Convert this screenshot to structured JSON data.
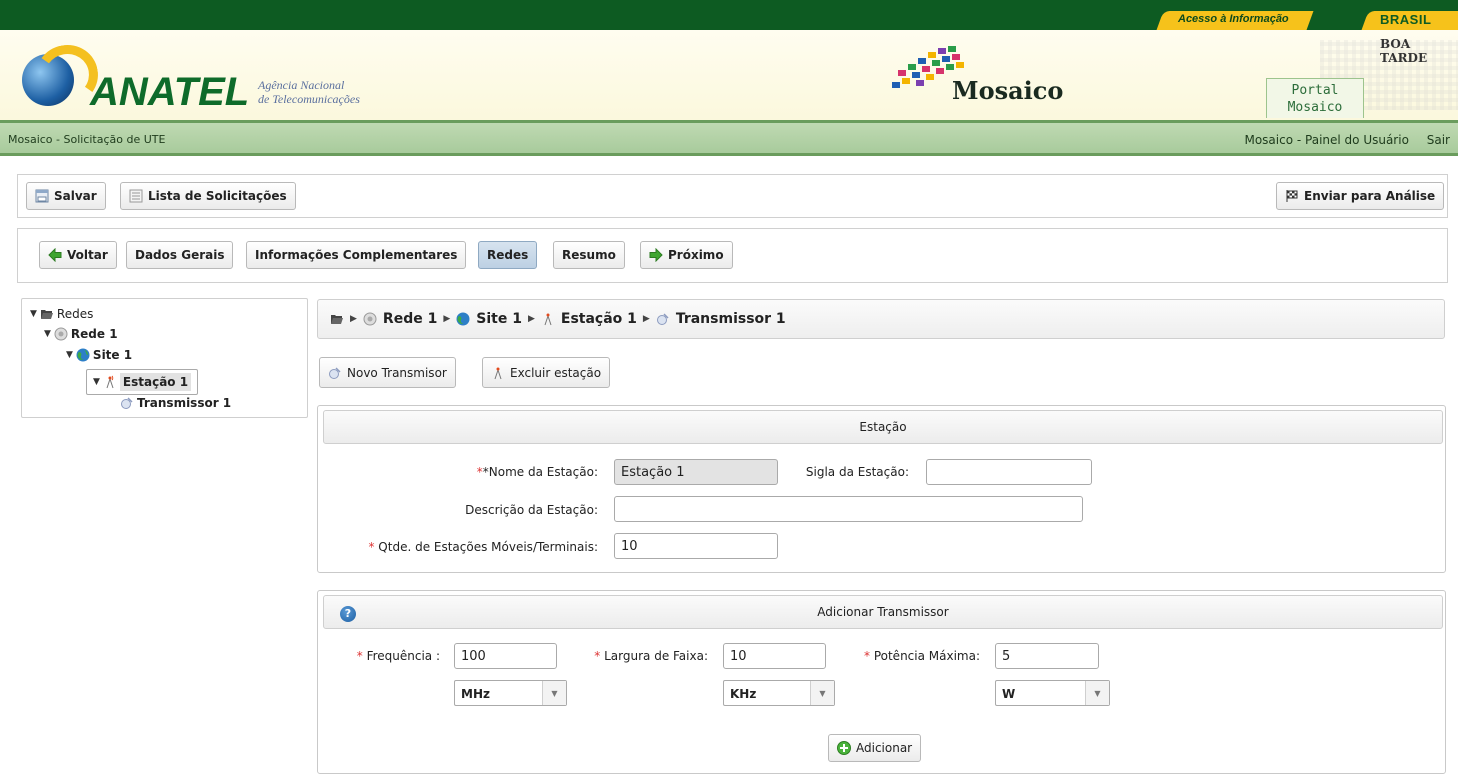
{
  "gov_bar": {
    "acesso": "Acesso à Informação",
    "brasil": "BRASIL"
  },
  "header": {
    "brand": "ANATEL",
    "agency_line1": "Agência Nacional",
    "agency_line2": "de Telecomunicações",
    "app_name": "Mosaico",
    "greeting": "BOA TARDE",
    "portal_line1": "Portal",
    "portal_line2": "Mosaico"
  },
  "subnav": {
    "left": "Mosaico - Solicitação de UTE",
    "panel_link": "Mosaico - Painel do Usuário",
    "logout": "Sair"
  },
  "toolbar": {
    "save": "Salvar",
    "list": "Lista de Solicitações",
    "submit": "Enviar para Análise"
  },
  "steps": {
    "back": "Voltar",
    "dados": "Dados Gerais",
    "info": "Informações Complementares",
    "redes": "Redes",
    "resumo": "Resumo",
    "next": "Próximo"
  },
  "tree": {
    "root": "Redes",
    "rede": "Rede 1",
    "site": "Site 1",
    "estacao": "Estação 1",
    "transmissor": "Transmissor 1"
  },
  "breadcrumb": [
    "Rede 1",
    "Site 1",
    "Estação 1",
    "Transmissor 1"
  ],
  "actions": {
    "new_tx": "Novo Transmisor",
    "delete_station": "Excluir estação"
  },
  "estacao_panel": {
    "title": "Estação",
    "nome_label": "*Nome da Estação:",
    "nome_value": "Estação 1",
    "sigla_label": "Sigla da Estação:",
    "sigla_value": "",
    "descricao_label": "Descrição da Estação:",
    "descricao_value": "",
    "qtde_label": "Qtde. de Estações Móveis/Terminais:",
    "qtde_value": "10"
  },
  "transmissor_panel": {
    "title": "Adicionar Transmissor",
    "freq_label": "Frequência :",
    "freq_value": "100",
    "freq_unit": "MHz",
    "largura_label": "Largura de Faixa:",
    "largura_value": "10",
    "largura_unit": "KHz",
    "potencia_label": "Potência Máxima:",
    "potencia_value": "5",
    "potencia_unit": "W",
    "add": "Adicionar"
  },
  "colors": {
    "brand_green": "#0d5b22",
    "gov_yellow": "#f6c21b",
    "active_tab": "#bdd0e3"
  }
}
